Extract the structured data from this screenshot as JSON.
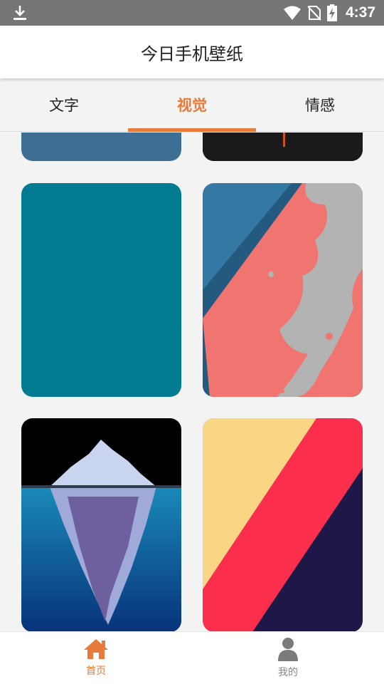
{
  "status_bar": {
    "time": "4:37",
    "icons": [
      "download-icon",
      "wifi-icon",
      "no-sim-icon",
      "battery-charging-icon"
    ]
  },
  "app_bar": {
    "title": "今日手机壁纸"
  },
  "tabs": [
    {
      "label": "文字",
      "active": false
    },
    {
      "label": "视觉",
      "active": true
    },
    {
      "label": "情感",
      "active": false
    }
  ],
  "wallpapers": [
    {
      "name": "steel-blue-partial",
      "colors": [
        "#3d6f95"
      ]
    },
    {
      "name": "black-orange-partial",
      "colors": [
        "#111111",
        "#c9521e"
      ]
    },
    {
      "name": "teal-solid",
      "colors": [
        "#007b92"
      ]
    },
    {
      "name": "abstract-coral-gray",
      "colors": [
        "#f07470",
        "#b3b3b3",
        "#3479a3",
        "#255a80"
      ]
    },
    {
      "name": "iceberg",
      "colors": [
        "#000000",
        "#0d6fa8",
        "#c9d4ee",
        "#6e5f9e"
      ]
    },
    {
      "name": "diagonal-stripes",
      "colors": [
        "#f9d683",
        "#fb2e4c",
        "#1e1848"
      ]
    }
  ],
  "bottom_nav": [
    {
      "label": "首页",
      "icon": "home-icon",
      "active": true
    },
    {
      "label": "我的",
      "icon": "person-icon",
      "active": false
    }
  ],
  "colors": {
    "accent": "#e87a3b",
    "status_bar": "#767676"
  }
}
